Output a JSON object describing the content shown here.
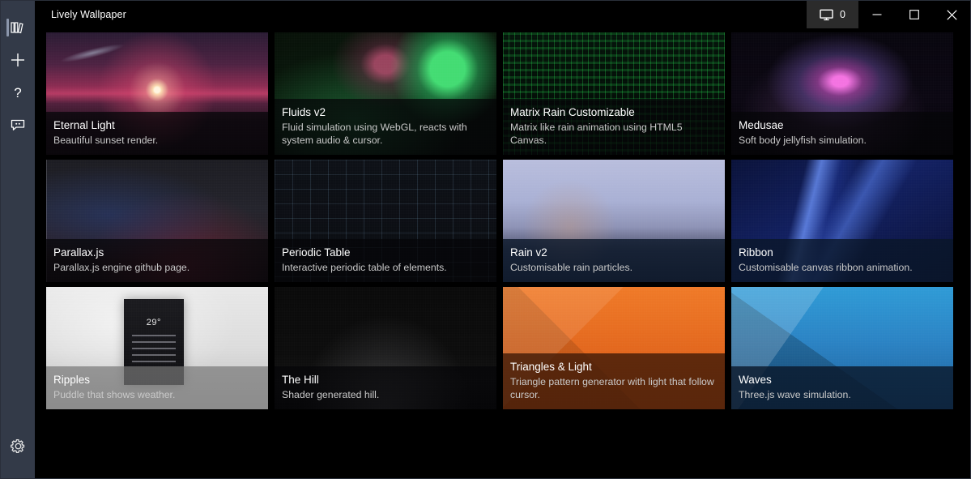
{
  "window": {
    "title": "Lively Wallpaper",
    "monitor_count": "0",
    "monitor_icon": "monitor-icon",
    "minimize_label": "–",
    "maximize_label": "□",
    "close_label": "✕"
  },
  "sidebar": {
    "items": [
      {
        "name": "library",
        "icon": "books-icon",
        "active": true
      },
      {
        "name": "add-wallpaper",
        "icon": "plus-icon",
        "active": false
      },
      {
        "name": "help",
        "icon": "question-mark-icon",
        "active": false
      },
      {
        "name": "feedback",
        "icon": "chat-bubble-icon",
        "active": false
      }
    ],
    "bottom_item": {
      "name": "settings",
      "icon": "gear-icon",
      "active": false
    }
  },
  "library": {
    "wallpapers": [
      {
        "title": "Eternal Light",
        "description": "Beautiful sunset render.",
        "thumb": "t-eternal"
      },
      {
        "title": "Fluids v2",
        "description": "Fluid simulation using WebGL, reacts with system audio & cursor.",
        "thumb": "t-fluids"
      },
      {
        "title": "Matrix Rain Customizable",
        "description": "Matrix like rain animation using HTML5 Canvas.",
        "thumb": "t-matrix"
      },
      {
        "title": "Medusae",
        "description": "Soft body jellyfish simulation.",
        "thumb": "t-medusae"
      },
      {
        "title": "Parallax.js",
        "description": "Parallax.js engine github page.",
        "thumb": "t-parallax"
      },
      {
        "title": "Periodic Table",
        "description": "Interactive periodic table of elements.",
        "thumb": "t-periodic"
      },
      {
        "title": "Rain v2",
        "description": "Customisable rain particles.",
        "thumb": "t-rain"
      },
      {
        "title": "Ribbon",
        "description": "Customisable canvas ribbon animation.",
        "thumb": "t-ribbon"
      },
      {
        "title": "Ripples",
        "description": "Puddle that shows weather.",
        "thumb": "t-ripples"
      },
      {
        "title": "The Hill",
        "description": "Shader generated hill.",
        "thumb": "t-thehill"
      },
      {
        "title": "Triangles & Light",
        "description": "Triangle pattern generator with light that follow cursor.",
        "thumb": "t-triangles"
      },
      {
        "title": "Waves",
        "description": "Three.js wave simulation.",
        "thumb": "t-waves"
      }
    ],
    "thumb_inner_text": {
      "ripples_temp": "29°"
    }
  },
  "colors": {
    "sidebar_bg": "#333a48",
    "content_bg": "#000000",
    "accent_indicator": "#8b96ab",
    "titlebar_button_bg": "#2b2b2b"
  }
}
